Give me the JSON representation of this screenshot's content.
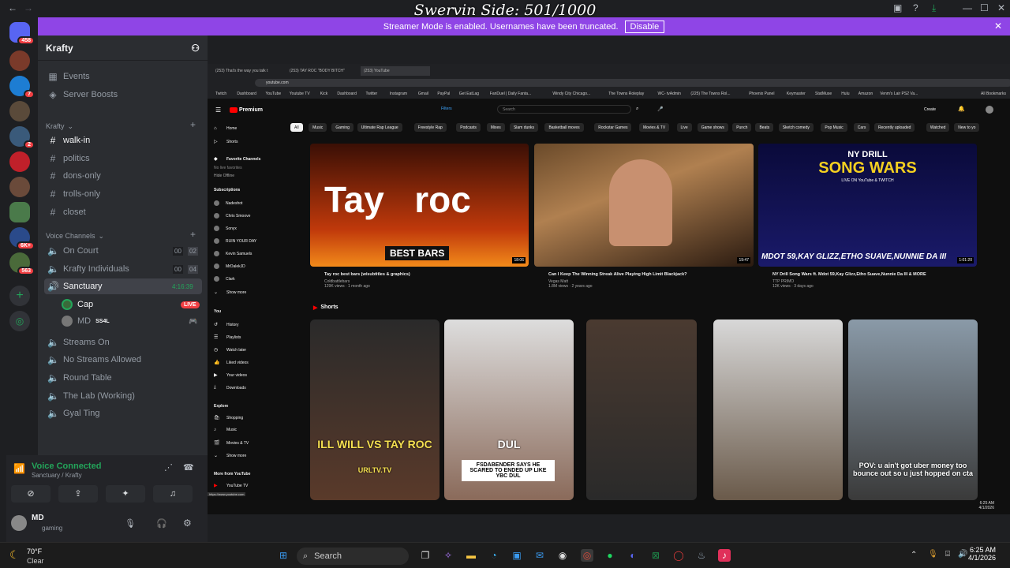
{
  "overlay_title": "Swervin Side: 501/1000",
  "streamer_banner": {
    "text": "Streamer Mode is enabled. Usernames have been truncated.",
    "button": "Disable"
  },
  "rail": {
    "badges": [
      "458",
      "7",
      "2",
      "6K+",
      "563"
    ]
  },
  "server": {
    "name": "Krafty",
    "items": [
      "Events",
      "Server Boosts"
    ],
    "category1": "Krafty",
    "text_channels": [
      "walk-in",
      "politics",
      "dons-only",
      "trolls-only",
      "closet"
    ],
    "category2": "Voice Channels",
    "voice": [
      {
        "name": "On Court",
        "a": "00",
        "b": "02"
      },
      {
        "name": "Krafty Individuals",
        "a": "00",
        "b": "04"
      },
      {
        "name": "Sanctuary",
        "time": "4:16:39"
      }
    ],
    "members": [
      {
        "name": "Cap",
        "badge": "LIVE"
      },
      {
        "name": "MD",
        "tag": "SS4L"
      }
    ],
    "more_voice": [
      "Streams On",
      "No Streams Allowed",
      "Round Table",
      "The Lab (Working)",
      "Gyal Ting"
    ]
  },
  "voice_connected": {
    "title": "Voice Connected",
    "sub": "Sanctuary / Krafty"
  },
  "user": {
    "name": "MD",
    "status": "gaming"
  },
  "browser": {
    "tabs": [
      "(253) That's the way you talk t",
      "(253) TAY ROC \"BODY BITCH\"",
      "(253) YouTube"
    ],
    "url": "youtube.com",
    "bookmarks": [
      "Twitch",
      "Dashboard",
      "YouTube",
      "Youtube TV",
      "Kick",
      "Dashboard",
      "Twitter",
      "Instagram",
      "Gmail",
      "PayPal",
      "Get EatLag",
      "FanDuel | Daily Fanta...",
      "Windy City Chicago...",
      "The Towns Roleplay",
      "WC- tvAdmin",
      "(225) The Towns Rol...",
      "Phoenix Panel",
      "Keymaster",
      "StatMuse",
      "Hulu",
      "Amazon",
      "Venm's Lair PS2 Va...",
      "All Bookmarks"
    ]
  },
  "yt": {
    "logo": "Premium",
    "search_placeholder": "Search",
    "filters": "Filters",
    "create": "Create",
    "side": {
      "home": "Home",
      "shorts": "Shorts",
      "fav": "Favorite Channels",
      "no_live": "No live favorites",
      "hide": "Hide Offline",
      "subs": "Subscriptions",
      "channels": [
        "Nadeshot",
        "Chris Smoove",
        "Sonyx",
        "RUIN YOUR DAY",
        "Kevin Samuels",
        "MrDalekJD",
        "Clark"
      ],
      "show_more": "Show more",
      "you": "You",
      "you_items": [
        "History",
        "Playlists",
        "Watch later",
        "Liked videos",
        "Your videos",
        "Downloads"
      ],
      "explore": "Explore",
      "explore_items": [
        "Shopping",
        "Music",
        "Movies & TV"
      ],
      "show_more2": "Show more",
      "more_from": "More from YouTube",
      "yttv": "YouTube TV",
      "status_url": "https://www.youtube.com"
    },
    "chips": [
      "All",
      "Music",
      "Gaming",
      "Ultimate Rap League",
      "Freestyle Rap",
      "Podcasts",
      "Mixes",
      "Slam dunks",
      "Basketball moves",
      "Rockstar Games",
      "Movies & TV",
      "Live",
      "Game shows",
      "Punch",
      "Beats",
      "Sketch comedy",
      "Pop Music",
      "Cars",
      "Recently uploaded",
      "Watched",
      "New to yo"
    ],
    "videos": [
      {
        "title": "Tay roc best bars (w/subtitles & graphics)",
        "channel": "Coldbattlebars",
        "meta": "129K views · 1 month ago",
        "dur": "18:06",
        "big": "Tay   roc",
        "overlay": "BEST BARS"
      },
      {
        "title": "Can I Keep The Winning Streak Alive Playing High Limit Blackjack?",
        "channel": "Vegas Matt",
        "meta": "1.8M views · 2 years ago",
        "dur": "19:47"
      },
      {
        "title": "NY Drill Song Wars ft. Mdot 59,Kay Glizz,Etho Suave,Nunnie Da III & MORE",
        "channel": "TTP PRIMO",
        "meta": "12K views · 3 days ago",
        "dur": "1:01:20",
        "big": "NY DRILL",
        "big2": "SONG WARS",
        "sub": "LIVE ON YouTube & TWITCH",
        "overlay": "MDOT 59,KAY GLIZZ,ETHO SUAVE,NUNNIE DA III"
      }
    ],
    "shorts_label": "Shorts",
    "shorts": [
      {
        "caption": "ILL WILL VS TAY ROC",
        "sub": "URLTV.TV"
      },
      {
        "caption": "FSDABENDER SAYS HE SCARED TO ENDED UP LIKE YBC DUL",
        "sub": "DUL"
      },
      {
        "caption": ""
      },
      {
        "caption": ""
      },
      {
        "caption": "POV: u ain't got uber money too bounce out so u just hopped on cta"
      }
    ],
    "clock": "6:25 AM",
    "date": "4/1/2026"
  },
  "taskbar": {
    "temp": "70°F",
    "weather": "Clear",
    "search": "Search",
    "time": "6:25 AM",
    "date": "4/1/2026"
  }
}
